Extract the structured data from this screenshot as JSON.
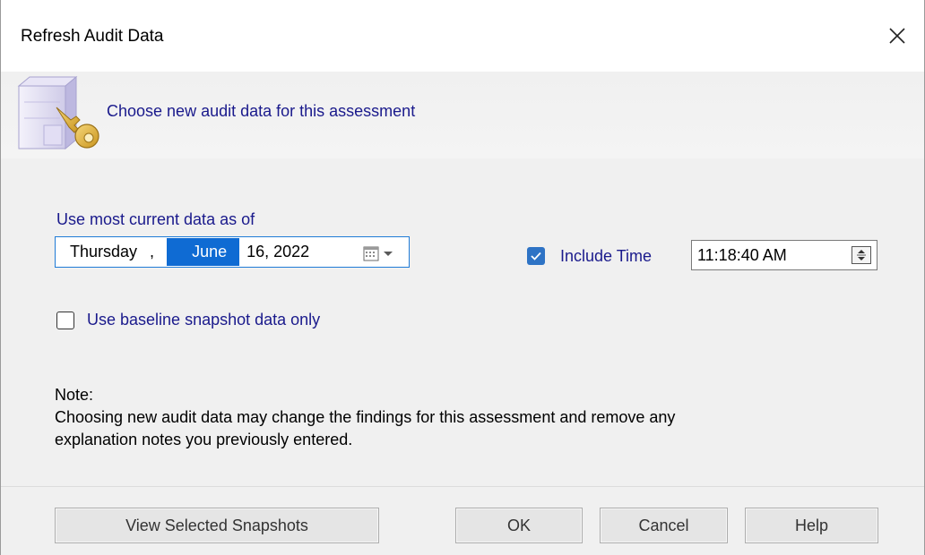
{
  "window": {
    "title": "Refresh Audit Data",
    "close_icon": "close-icon"
  },
  "header": {
    "text": "Choose new audit data for this assessment",
    "icon": "server-key-icon"
  },
  "form": {
    "current_label": "Use most current data as of",
    "date": {
      "day_of_week": "Thursday",
      "comma": ",",
      "month": "June",
      "day_year": "16, 2022"
    },
    "include_time": {
      "label": "Include Time",
      "checked": true
    },
    "time": {
      "value": "11:18:40 AM"
    },
    "baseline": {
      "label": "Use baseline snapshot data only",
      "checked": false
    }
  },
  "note": {
    "heading": "Note:",
    "line1": "Choosing new audit data may change the findings for this assessment and remove any",
    "line2": "explanation notes you previously entered."
  },
  "buttons": {
    "view_snapshots": "View Selected Snapshots",
    "ok": "OK",
    "cancel": "Cancel",
    "help": "Help"
  },
  "colors": {
    "accent": "#0f6bd3",
    "label_text": "#1a1a8c",
    "checkbox_checked": "#2e73c5"
  }
}
